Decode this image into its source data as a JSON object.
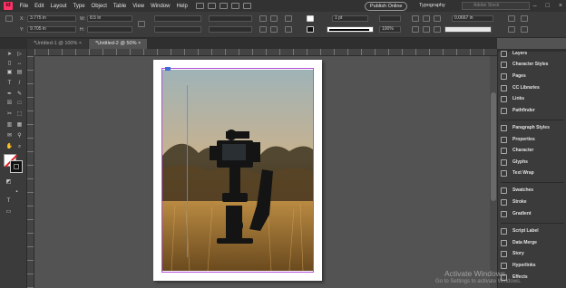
{
  "app": {
    "logo": "Id"
  },
  "menu": [
    "File",
    "Edit",
    "Layout",
    "Type",
    "Object",
    "Table",
    "View",
    "Window",
    "Help"
  ],
  "header": {
    "publish_label": "Publish Online",
    "workspace": "Typography",
    "stock_placeholder": "Adobe Stock"
  },
  "control": {
    "x_label": "X:",
    "x_value": "3.775 in",
    "y_label": "Y:",
    "y_value": "9.705 in",
    "w_label": "W:",
    "w_value": "8.5 in",
    "h_label": "H:",
    "stroke_weight": "1 pt",
    "opacity": "100%",
    "gap_value": "0.0667 in"
  },
  "tabs": [
    {
      "label": "*Untitled-1 @ 100%",
      "active": false
    },
    {
      "label": "*Untitled-2 @ 50%",
      "active": true
    }
  ],
  "panels": {
    "group1": [
      "Layers",
      "Character Styles",
      "Pages",
      "CC Libraries",
      "Links",
      "Pathfinder"
    ],
    "group2": [
      "Paragraph Styles",
      "Properties",
      "Character",
      "Glyphs",
      "Text Wrap"
    ],
    "group3": [
      "Swatches",
      "Stroke",
      "Gradient"
    ],
    "group4": [
      "Script Label",
      "Data Merge",
      "Story",
      "Hyperlinks",
      "Effects"
    ]
  },
  "watermark": {
    "line1": "Activate Windows",
    "line2": "Go to Settings to activate Windows."
  },
  "colors": {
    "accent": "#ff3366",
    "frame": "#b24fd6",
    "guide": "#5b8de8"
  }
}
